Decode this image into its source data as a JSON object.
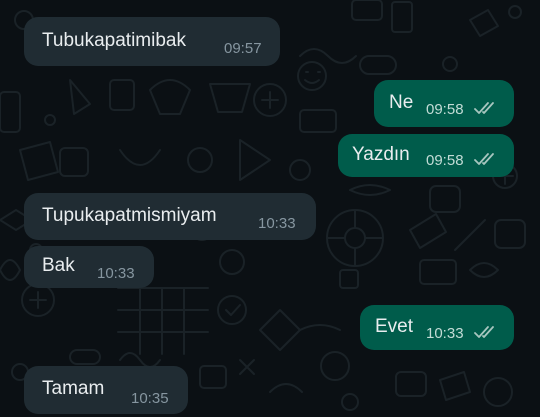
{
  "colors": {
    "background": "#0b1014",
    "incoming_bubble": "#202c33",
    "outgoing_bubble": "#005c4b",
    "text": "#e9edef",
    "incoming_time": "#8696a0",
    "outgoing_time": "#c2dcd6",
    "read_ticks": "#a7c6bf"
  },
  "messages": [
    {
      "direction": "incoming",
      "text": "Tubukapatimibak",
      "time": "09:57"
    },
    {
      "direction": "outgoing",
      "text": "Ne",
      "time": "09:58",
      "status": "double-check-icon"
    },
    {
      "direction": "outgoing",
      "text": "Yazdın",
      "time": "09:58",
      "status": "double-check-icon"
    },
    {
      "direction": "incoming",
      "text": "Tupukapatmismiyam",
      "time": "10:33"
    },
    {
      "direction": "incoming",
      "text": "Bak",
      "time": "10:33"
    },
    {
      "direction": "outgoing",
      "text": "Evet",
      "time": "10:33",
      "status": "double-check-icon"
    },
    {
      "direction": "incoming",
      "text": "Tamam",
      "time": "10:35"
    }
  ]
}
